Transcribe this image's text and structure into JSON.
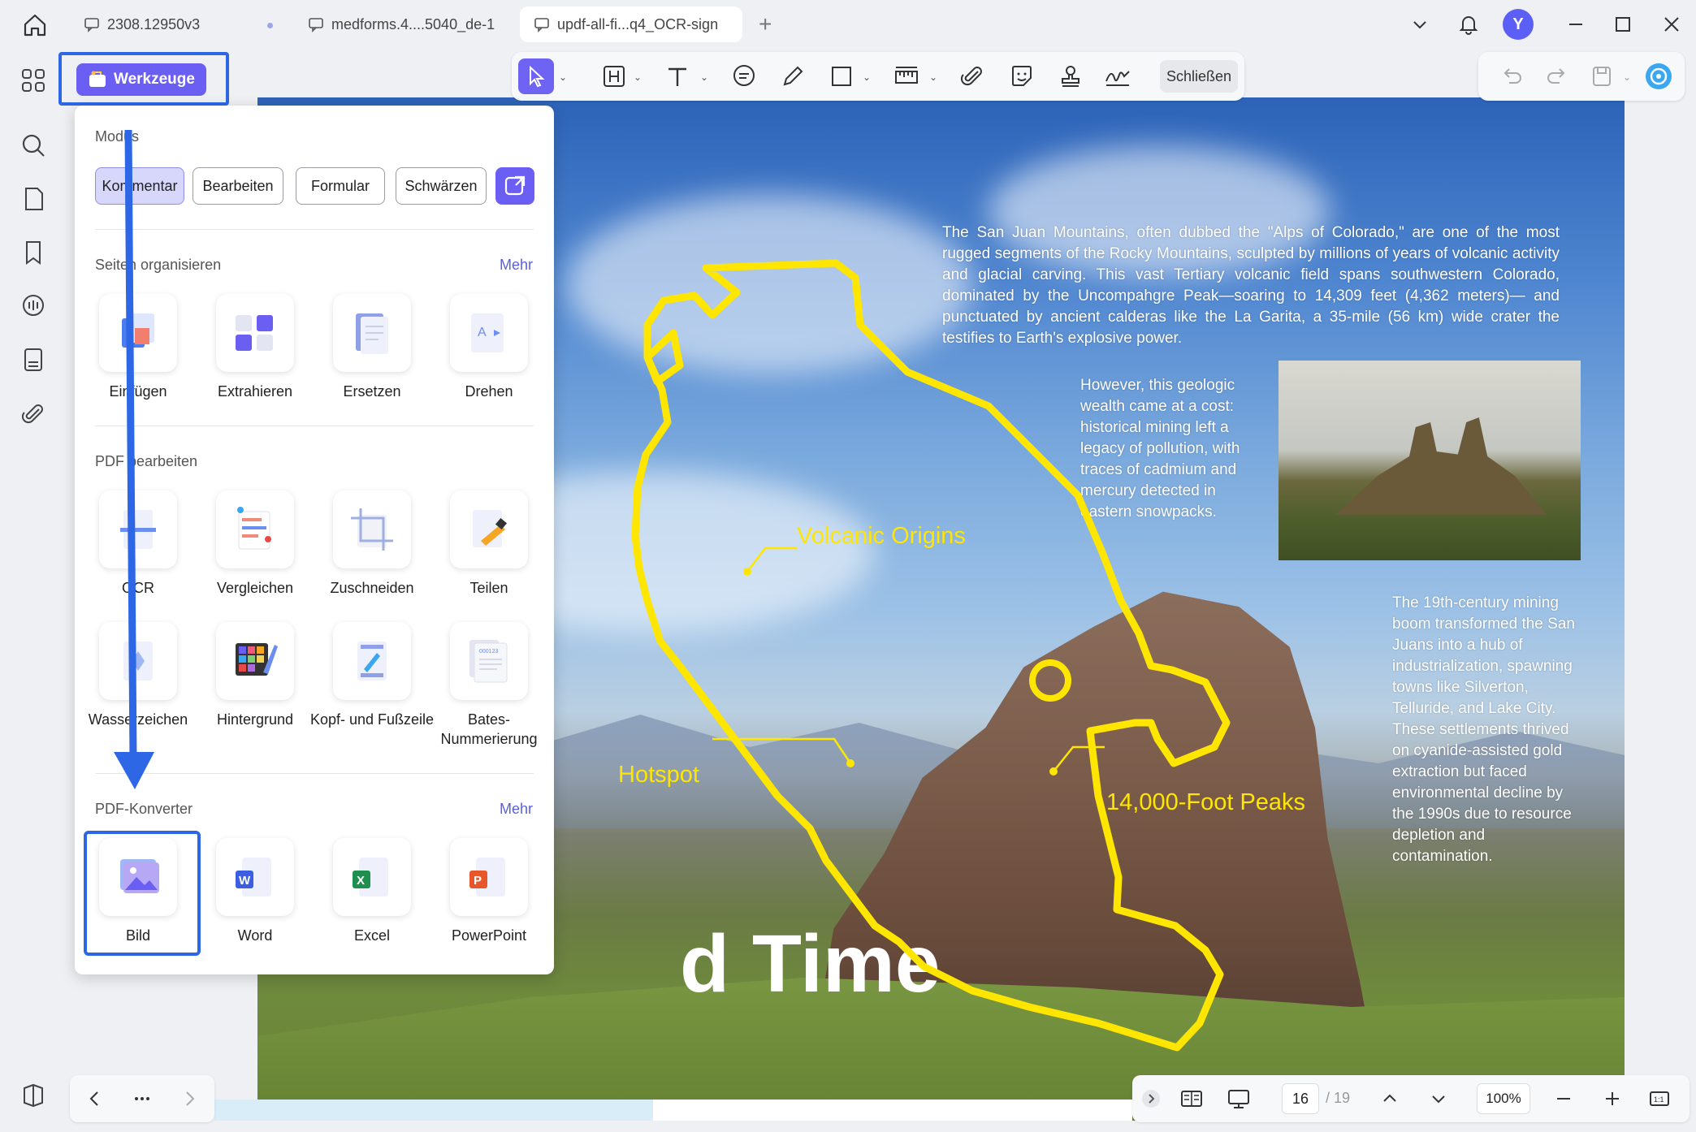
{
  "tabs": [
    {
      "label": "2308.12950v3",
      "unsaved": true
    },
    {
      "label": "medforms.4....5040_de-1"
    },
    {
      "label": "updf-all-fi...q4_OCR-sign",
      "active": true
    }
  ],
  "user": {
    "avatar_letter": "Y",
    "avatar_color": "#5b5ff5"
  },
  "toolbar": {
    "close_label": "Schließen"
  },
  "werkzeuge": {
    "label": "Werkzeuge"
  },
  "panel": {
    "mode_title": "Modus",
    "modes": [
      "Kommentar",
      "Bearbeiten",
      "Formular",
      "Schwärzen"
    ],
    "active_mode": "Kommentar",
    "sections": [
      {
        "title": "Seiten organisieren",
        "more": "Mehr",
        "items": [
          "Einfügen",
          "Extrahieren",
          "Ersetzen",
          "Drehen"
        ]
      },
      {
        "title": "PDF bearbeiten",
        "more": "",
        "items": [
          "OCR",
          "Vergleichen",
          "Zuschneiden",
          "Teilen",
          "Wasserzeichen",
          "Hintergrund",
          "Kopf- und Fußzeile",
          "Bates-Nummerierung"
        ]
      },
      {
        "title": "PDF-Konverter",
        "more": "Mehr",
        "items": [
          "Bild",
          "Word",
          "Excel",
          "PowerPoint"
        ]
      }
    ]
  },
  "page": {
    "paragraph_1": "The San Juan Mountains, often dubbed the \"Alps of Colorado,\" are one of the most rugged segments of the Rocky Mountains, sculpted by millions of years of volcanic activity and glacial carving. This vast Tertiary volcanic field spans southwestern Colorado, dominated by the Uncompahgre Peak—soaring to 14,309 feet (4,362 meters)— and punctuated by ancient calderas like the La Garita, a 35-mile (56 km) wide crater the testifies to Earth's explosive power.",
    "paragraph_2": "However, this geologic wealth came at a cost: historical mining left a legacy of pollution, with traces of cadmium and mercury detected in eastern snowpacks.",
    "paragraph_3": "The 19th-century mining boom transformed the San Juans into a hub of industrialization, spawning towns like Silverton, Telluride, and Lake City. These settlements thrived on cyanide-assisted gold extraction but faced environmental decline by the 1990s due to resource depletion and contamination.",
    "annotation_1": "Volcanic Origins",
    "annotation_2": "Hotspot",
    "annotation_3": "14,000-Foot Peaks",
    "big_title": "d Time"
  },
  "bottom": {
    "current_page": "16",
    "total_pages": "/ 19",
    "zoom": "100%"
  },
  "colors": {
    "accent": "#6b5ef3",
    "highlight": "#2e67e6",
    "annotation": "#ffe600"
  }
}
